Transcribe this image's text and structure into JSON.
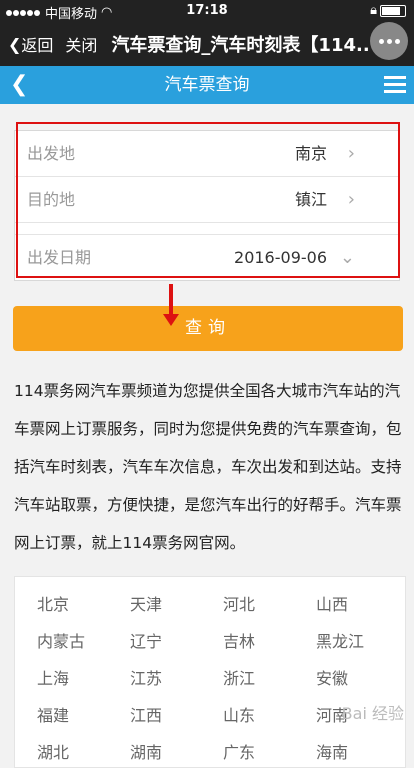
{
  "status": {
    "carrier": "中国移动",
    "time": "17:18"
  },
  "wx": {
    "back": "返回",
    "close": "关闭",
    "title": "汽车票查询_汽车时刻表【114..."
  },
  "header": {
    "title": "汽车票查询"
  },
  "form": {
    "depart_label": "出发地",
    "depart_value": "南京",
    "dest_label": "目的地",
    "dest_value": "镇江",
    "date_label": "出发日期",
    "date_value": "2016-09-06"
  },
  "search_button": "查询",
  "description": "114票务网汽车票频道为您提供全国各大城市汽车站的汽车票网上订票服务，同时为您提供免费的汽车票查询，包括汽车时刻表，汽车车次信息，车次出发和到达站。支持汽车站取票，方便快捷，是您汽车出行的好帮手。汽车票网上订票，就上114票务网官网。",
  "cities": [
    "北京",
    "天津",
    "河北",
    "山西",
    "内蒙古",
    "辽宁",
    "吉林",
    "黑龙江",
    "上海",
    "江苏",
    "浙江",
    "安徽",
    "福建",
    "江西",
    "山东",
    "河南",
    "湖北",
    "湖南",
    "广东",
    "海南"
  ],
  "watermark": "Bai 经验"
}
